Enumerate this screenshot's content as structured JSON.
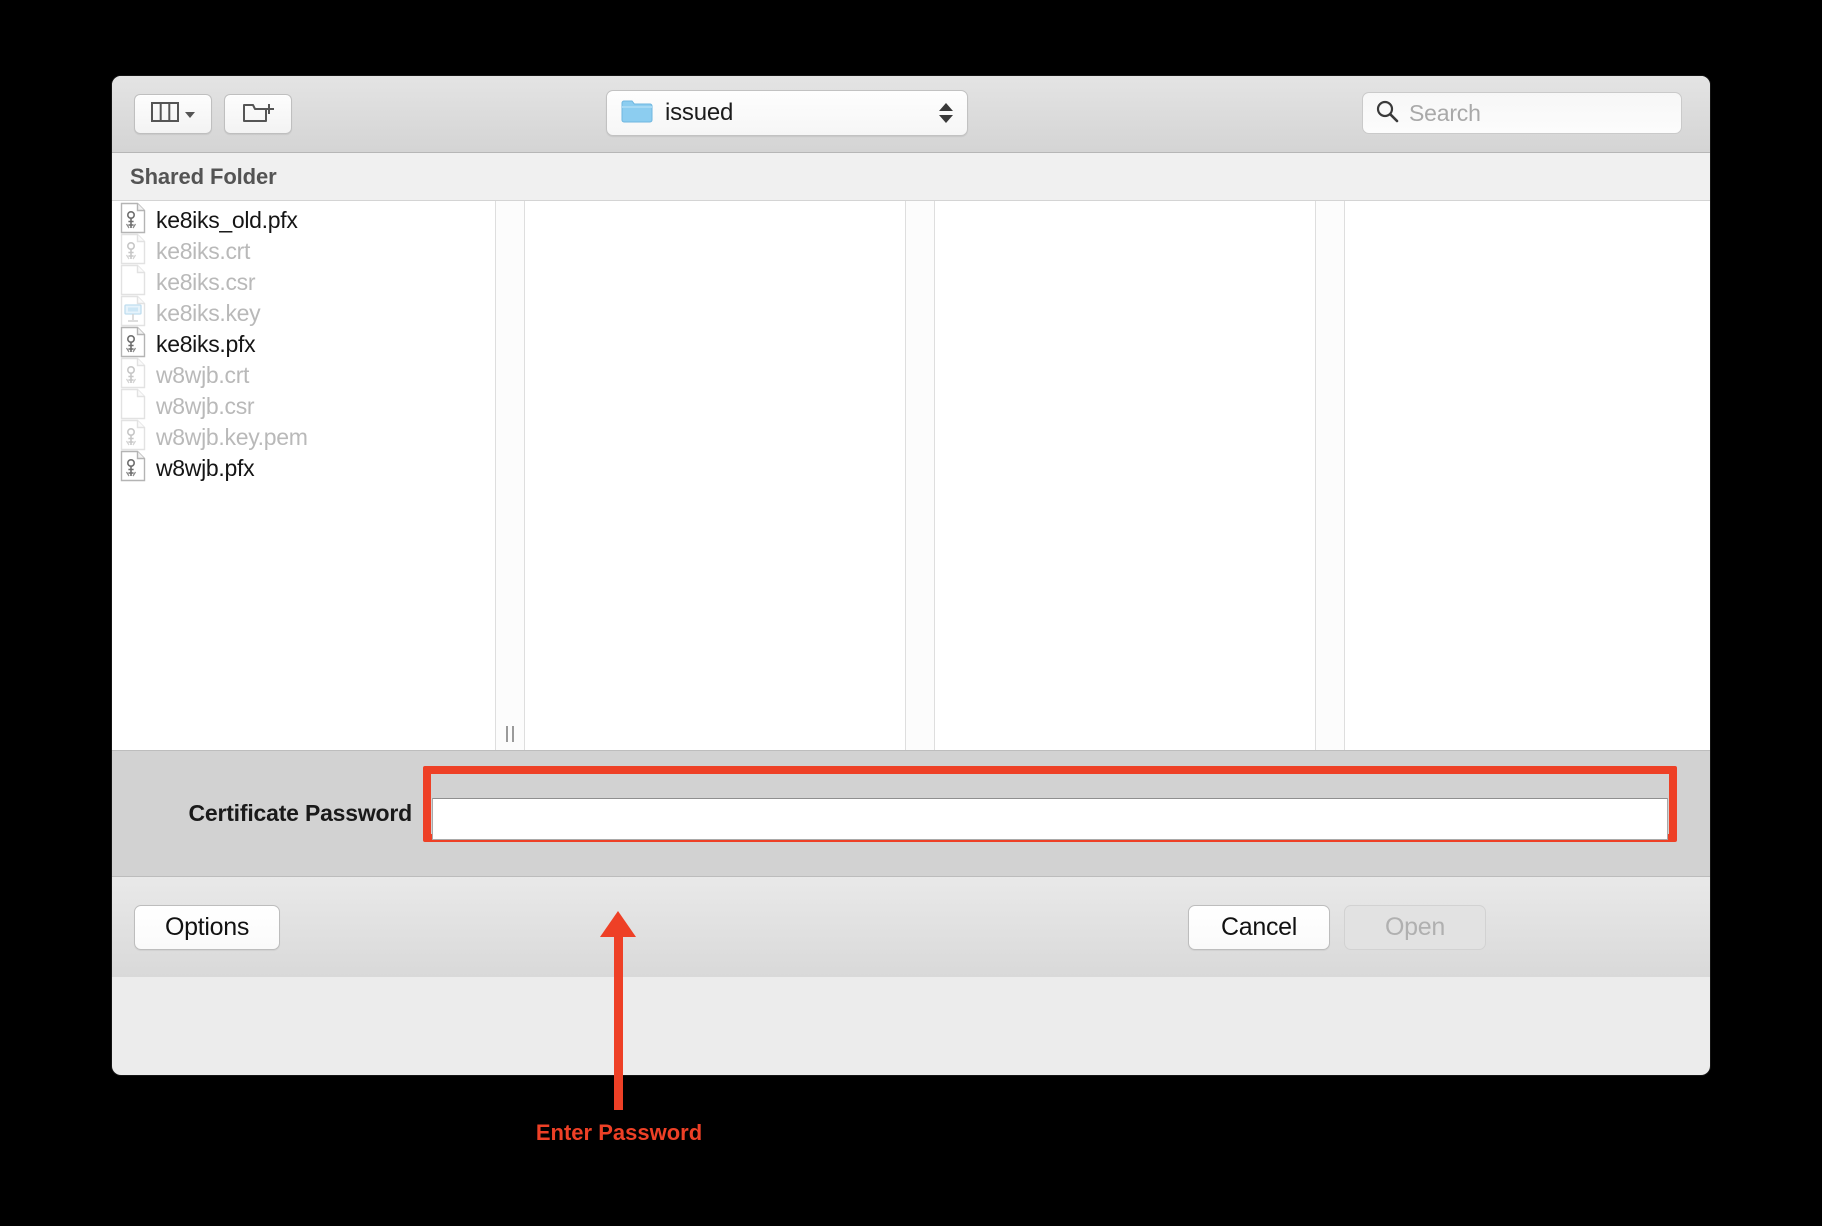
{
  "toolbar": {
    "view_button": {
      "icon": "column-view-icon",
      "menu_icon": "chevron-down-icon"
    },
    "new_folder_button": {
      "icon": "new-folder-icon"
    },
    "path_popup": {
      "label": "issued",
      "folder_icon": "folder-icon",
      "stepper_icon": "up-down-chevron-icon"
    },
    "search": {
      "placeholder": "Search",
      "value": "",
      "icon": "search-icon"
    }
  },
  "section": {
    "title": "Shared Folder"
  },
  "files": [
    {
      "name": "ke8iks_old.pfx",
      "icon": "certificate-keychain-icon",
      "enabled": true
    },
    {
      "name": "ke8iks.crt",
      "icon": "certificate-keychain-icon",
      "enabled": false
    },
    {
      "name": "ke8iks.csr",
      "icon": "blank-document-icon",
      "enabled": false
    },
    {
      "name": "ke8iks.key",
      "icon": "keynote-document-icon",
      "enabled": false
    },
    {
      "name": "ke8iks.pfx",
      "icon": "certificate-keychain-icon",
      "enabled": true
    },
    {
      "name": "w8wjb.crt",
      "icon": "certificate-keychain-icon",
      "enabled": false
    },
    {
      "name": "w8wjb.csr",
      "icon": "blank-document-icon",
      "enabled": false
    },
    {
      "name": "w8wjb.key.pem",
      "icon": "certificate-keychain-icon",
      "enabled": false
    },
    {
      "name": "w8wjb.pfx",
      "icon": "certificate-keychain-icon",
      "enabled": true
    }
  ],
  "accessory": {
    "password_label": "Certificate Password",
    "password_value": "",
    "password_placeholder": ""
  },
  "bottom_bar": {
    "options_label": "Options",
    "cancel_label": "Cancel",
    "open_label": "Open",
    "open_disabled": true
  },
  "annotation": {
    "text": "Enter Password",
    "color": "#ee4026"
  },
  "colors": {
    "annotation_red": "#ee4026",
    "folder_blue": "#8ccdf0",
    "accessory_gray": "#d2d2d2",
    "toolbar_gray": "#dcdcdc",
    "disabled_text": "#b9b9b9",
    "enabled_text": "#151515"
  }
}
